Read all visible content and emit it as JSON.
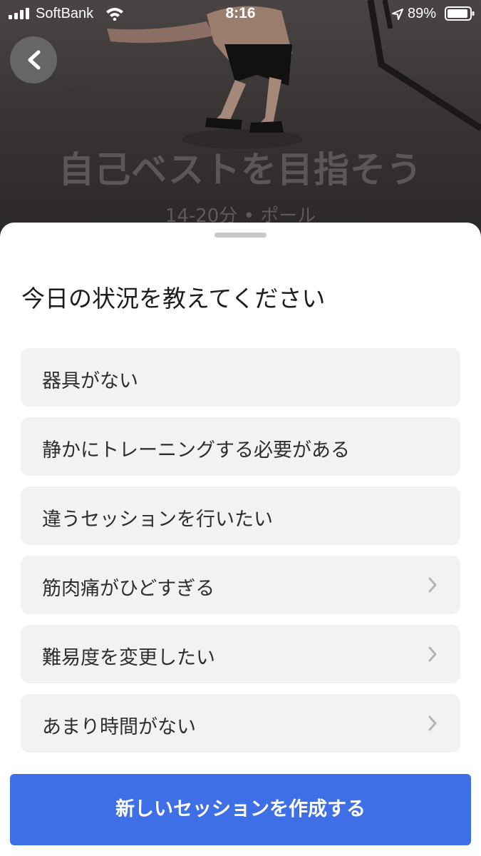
{
  "status_bar": {
    "carrier": "SoftBank",
    "time": "8:16",
    "battery": "89%",
    "icons": [
      "signal-icon",
      "wifi-icon",
      "location-arrow-icon",
      "battery-icon"
    ]
  },
  "hero": {
    "title": "自己ベストを目指そう",
    "subtitle": "14-20分 • ポール"
  },
  "sheet": {
    "title": "今日の状況を教えてください",
    "options": [
      {
        "label": "器具がない",
        "has_chevron": false
      },
      {
        "label": "静かにトレーニングする必要がある",
        "has_chevron": false
      },
      {
        "label": "違うセッションを行いたい",
        "has_chevron": false
      },
      {
        "label": "筋肉痛がひどすぎる",
        "has_chevron": true
      },
      {
        "label": "難易度を変更したい",
        "has_chevron": true
      },
      {
        "label": "あまり時間がない",
        "has_chevron": true
      }
    ],
    "cta_label": "新しいセッションを作成する"
  },
  "colors": {
    "accent": "#3f6fe6",
    "option_bg": "#f2f2f2",
    "sheet_bg": "#ffffff"
  }
}
